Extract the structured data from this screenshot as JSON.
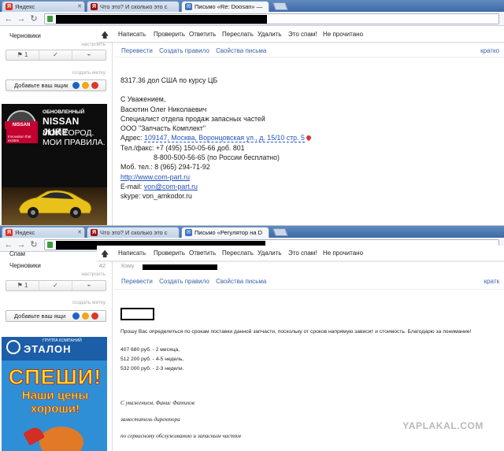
{
  "window1": {
    "tabs": [
      {
        "label": "Яндекс",
        "favicon": "yandex-icon",
        "color": "#e03020"
      },
      {
        "label": "Что это? И сколько это с",
        "favicon": "yaplakal-icon",
        "color": "#a01010"
      },
      {
        "label": "Письмо «Re: Doosan» —",
        "favicon": "mail-icon",
        "color": "#3a72c4"
      }
    ],
    "toolbar": [
      "Написать",
      "Проверить",
      "Ответить",
      "Переслать",
      "Удалить",
      "Это спам!",
      "Не прочитано"
    ],
    "sidebar": {
      "folder": "Черновики",
      "settings_hint": "настроить",
      "flag_count": "1",
      "create_label_hint": "создать метку",
      "add_button": "Добавьте ваш ящик"
    },
    "ad": {
      "brand": "NISSAN",
      "badge": "Innovation that excites",
      "line1": "ОБНОВЛЕННЫЙ",
      "line2": "NISSAN JUKE",
      "line3": "МОЙ ГОРОД.",
      "line4": "МОИ ПРАВИЛА."
    },
    "actions": [
      "Перевести",
      "Создать правило",
      "Свойства письма"
    ],
    "kratko": "кратко",
    "body": {
      "price": "8317.36 дол США по курсу ЦБ",
      "greeting": "С Уважением,",
      "name": "Васютин Олег Николаевич",
      "position": "Специалист отдела продаж запасных частей",
      "company": "ООО \"Запчасть Комплект\"",
      "address_label": "Адрес:",
      "address": "109147, Москва, Воронцовская ул., д. 15/10 стр. 5",
      "phone": "Тел./факс: +7 (495) 150-05-66 доб. 801",
      "phone2": "8-800-500-56-65 (по России бесплатно)",
      "mobile": "Моб. тел.: 8 (965) 294-71-92",
      "website": "http://www.com-part.ru",
      "email_label": "E-mail:",
      "email": "von@com-part.ru",
      "skype": "skype: von_amkodor.ru"
    }
  },
  "window2": {
    "tabs": [
      {
        "label": "Яндекс",
        "favicon": "yandex-icon",
        "color": "#e03020"
      },
      {
        "label": "Что это? И сколько это с",
        "favicon": "yaplakal-icon",
        "color": "#a01010"
      },
      {
        "label": "Письмо «Регулятор на D",
        "favicon": "mail-icon",
        "color": "#3a72c4"
      }
    ],
    "toolbar": [
      "Написать",
      "Проверить",
      "Ответить",
      "Переслать",
      "Удалить",
      "Это спам!",
      "Не прочитано"
    ],
    "sidebar": {
      "folder_spam": "Спам",
      "folder_drafts": "Черновики",
      "drafts_count": "42",
      "settings_hint": "настроить",
      "flag_count": "1",
      "create_label_hint": "создать метку",
      "add_button": "Добавьте ваш ящи"
    },
    "ad": {
      "group": "ГРУППА КОМПАНИЙ",
      "brand": "ЭТАЛОН",
      "line1": "СПЕШИ!",
      "line2": "Наши цены хороши!"
    },
    "kogo": "Кому",
    "actions": [
      "Перевести",
      "Создать правило",
      "Свойства письма"
    ],
    "kratko": "кратк",
    "body": {
      "request": "Прошу Вас определиться по срокам поставки данной запчасти, поскольку от сроков напрямую зависит и стоимость. Благодарю за понимание!",
      "price1": "407 680 руб. - 2 месяца,",
      "price2": "512 200 руб. - 4-5 недель,",
      "price3": "532 000 руб. - 2-3 недели.",
      "sig1": "С уважением, Фанис Фатихов",
      "sig2": "заместитель директора",
      "sig3": "по сервисному обслуживанию и запасным частям"
    }
  },
  "watermark": "YAPLAKAL.COM"
}
